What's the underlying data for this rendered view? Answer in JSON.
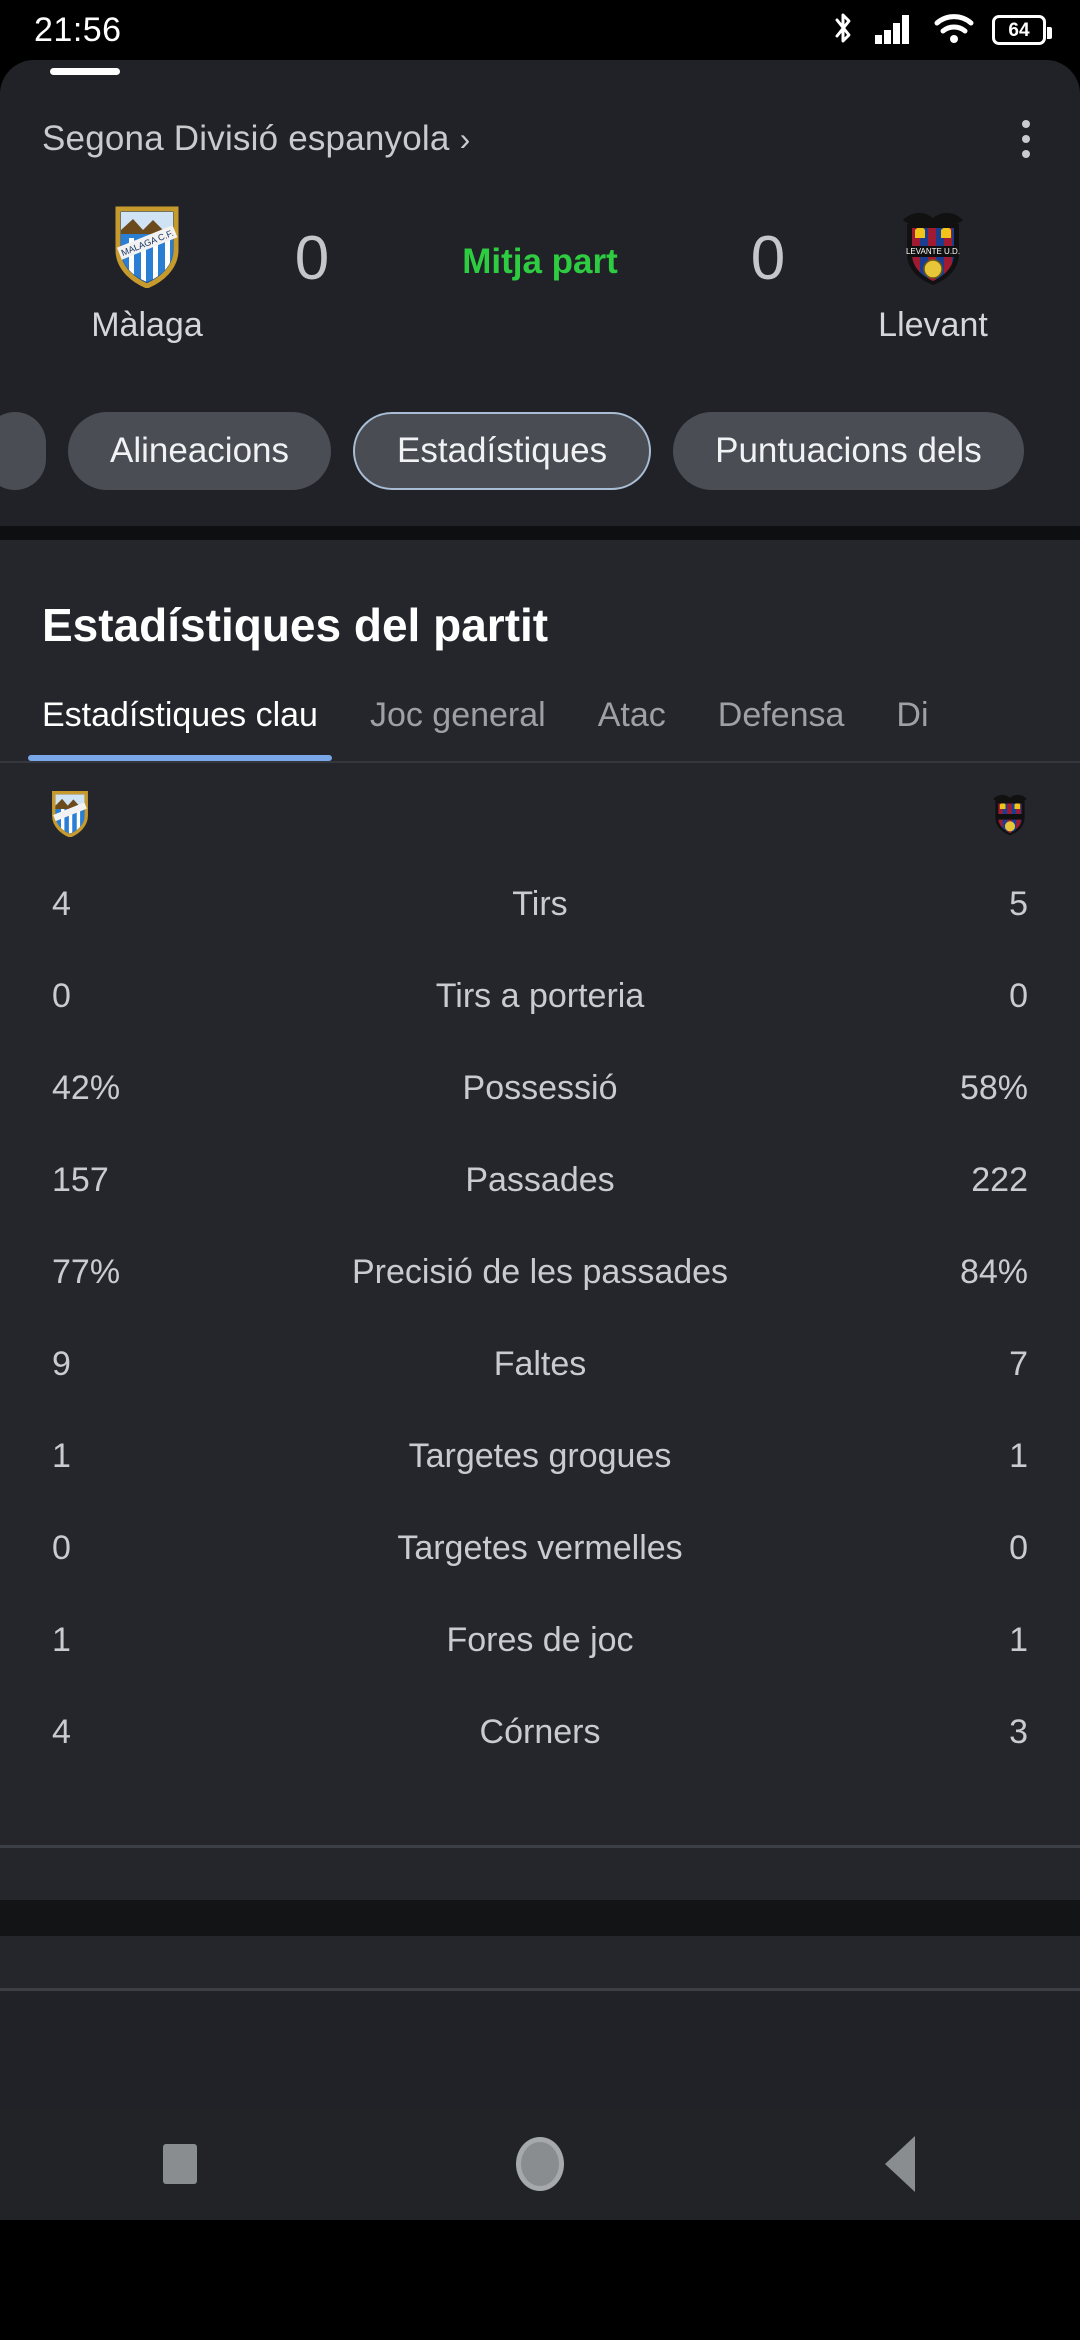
{
  "status_bar": {
    "time": "21:56",
    "battery_level": "64",
    "icons": [
      "bluetooth-icon",
      "cellular-signal-icon",
      "wifi-icon",
      "battery-icon"
    ]
  },
  "match_header": {
    "league": "Segona Divisió espanyola",
    "league_chevron": "›",
    "overflow_menu": "more-options",
    "home_team": {
      "name": "Màlaga",
      "score": "0",
      "crest": "malaga-crest"
    },
    "away_team": {
      "name": "Llevant",
      "score": "0",
      "crest": "levante-crest"
    },
    "period": "Mitja part",
    "period_color": "#2ecc40"
  },
  "chips": [
    {
      "label": "",
      "selected": false,
      "partial": true
    },
    {
      "label": "Alineacions",
      "selected": false,
      "partial": false
    },
    {
      "label": "Estadístiques",
      "selected": true,
      "partial": false
    },
    {
      "label": "Puntuacions dels ",
      "selected": false,
      "partial": false
    }
  ],
  "stats_card": {
    "title": "Estadístiques del partit",
    "tabs": [
      {
        "label": "Estadístiques clau",
        "active": true
      },
      {
        "label": "Joc general",
        "active": false
      },
      {
        "label": "Atac",
        "active": false
      },
      {
        "label": "Defensa",
        "active": false
      },
      {
        "label": "Di",
        "active": false
      }
    ],
    "active_tab_indicator_color": "#7aa7e8",
    "rows": [
      {
        "home": "4",
        "label": "Tirs",
        "away": "5"
      },
      {
        "home": "0",
        "label": "Tirs a porteria",
        "away": "0"
      },
      {
        "home": "42%",
        "label": "Possessió",
        "away": "58%"
      },
      {
        "home": "157",
        "label": "Passades",
        "away": "222"
      },
      {
        "home": "77%",
        "label": "Precisió de les passades",
        "away": "84%"
      },
      {
        "home": "9",
        "label": "Faltes",
        "away": "7"
      },
      {
        "home": "1",
        "label": "Targetes grogues",
        "away": "1"
      },
      {
        "home": "0",
        "label": "Targetes vermelles",
        "away": "0"
      },
      {
        "home": "1",
        "label": "Fores de joc",
        "away": "1"
      },
      {
        "home": "4",
        "label": "Córners",
        "away": "3"
      }
    ]
  },
  "nav_bar": {
    "recents": "square-icon",
    "home": "circle-icon",
    "back": "triangle-back-icon"
  }
}
